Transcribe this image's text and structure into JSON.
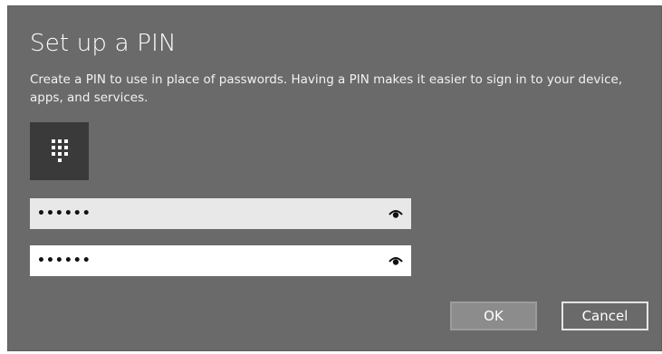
{
  "dialog": {
    "title": "Set up a PIN",
    "description": "Create a PIN to use in place of passwords. Having a PIN makes it easier to sign in to your device, apps, and services.",
    "icon": "keypad-icon"
  },
  "fields": {
    "new_pin": {
      "value": "••••••",
      "reveal_icon": "eye-icon"
    },
    "confirm_pin": {
      "value": "••••••",
      "reveal_icon": "eye-icon"
    }
  },
  "buttons": {
    "ok": "OK",
    "cancel": "Cancel"
  },
  "colors": {
    "dialog_bg": "#6a6a6a",
    "icon_tile": "#3a3a3a",
    "ok_bg": "#8c8c8c"
  }
}
